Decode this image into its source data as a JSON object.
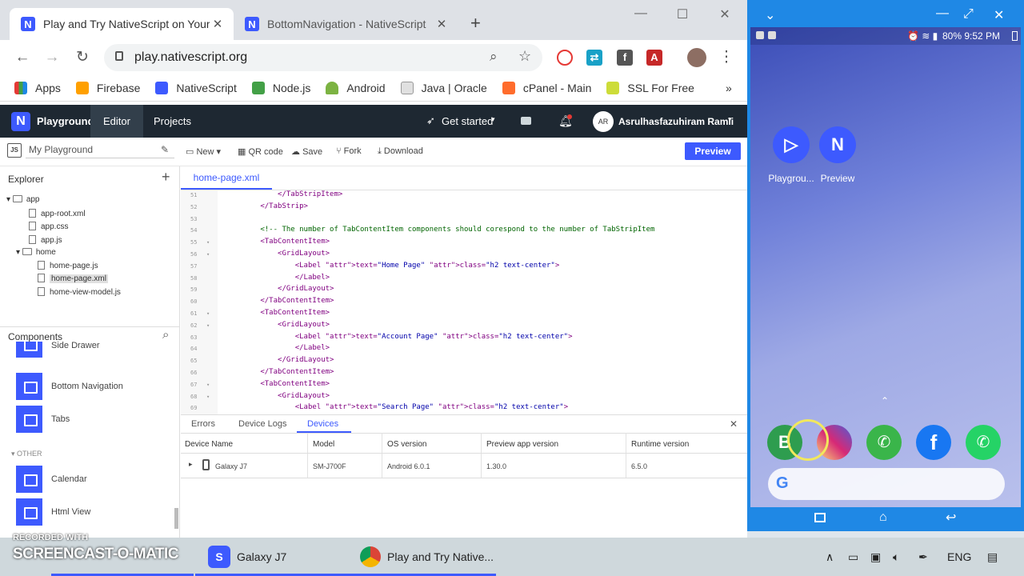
{
  "browser": {
    "tabs": [
      {
        "title": "Play and Try NativeScript on Your",
        "active": true
      },
      {
        "title": "BottomNavigation - NativeScript",
        "active": false
      }
    ],
    "url": "play.nativescript.org",
    "bookmarks": [
      "Apps",
      "Firebase",
      "NativeScript",
      "Node.js",
      "Android",
      "Java | Oracle",
      "cPanel - Main",
      "SSL For Free"
    ],
    "bookmarks_more": "»"
  },
  "app": {
    "brand": "Playground",
    "nav": [
      "Editor",
      "Projects"
    ],
    "get_started": "Get started",
    "user_initials": "AR",
    "user_name": "Asrulhasfazuhiram Ramli",
    "project_name": "My Playground",
    "toolbar": {
      "new": "New",
      "qr": "QR code",
      "save": "Save",
      "fork": "Fork",
      "download": "Download",
      "preview": "Preview"
    },
    "explorer_title": "Explorer",
    "tree": [
      {
        "label": "app",
        "type": "folder"
      },
      {
        "label": "app-root.xml",
        "type": "file"
      },
      {
        "label": "app.css",
        "type": "file"
      },
      {
        "label": "app.js",
        "type": "file"
      },
      {
        "label": "home",
        "type": "folder"
      },
      {
        "label": "home-page.js",
        "type": "file"
      },
      {
        "label": "home-page.xml",
        "type": "file",
        "selected": true
      },
      {
        "label": "home-view-model.js",
        "type": "file"
      }
    ],
    "components_title": "Components",
    "components": [
      "Side Drawer",
      "Bottom Navigation",
      "Tabs"
    ],
    "components_section": "OTHER",
    "components_other": [
      "Calendar",
      "Html View"
    ],
    "editor_tab": "home-page.xml",
    "code": [
      {
        "ln": "51",
        "t": "            </TabStripItem>"
      },
      {
        "ln": "52",
        "t": "        </TabStrip>"
      },
      {
        "ln": "53",
        "t": ""
      },
      {
        "ln": "54",
        "t": "        <!-- The number of TabContentItem components should corespond to the number of TabStripItem"
      },
      {
        "ln": "55",
        "t": "        <TabContentItem>"
      },
      {
        "ln": "56",
        "t": "            <GridLayout>"
      },
      {
        "ln": "57",
        "t": "                <Label text=\"Home Page\" class=\"h2 text-center\">"
      },
      {
        "ln": "58",
        "t": "                </Label>"
      },
      {
        "ln": "59",
        "t": "            </GridLayout>"
      },
      {
        "ln": "60",
        "t": "        </TabContentItem>"
      },
      {
        "ln": "61",
        "t": "        <TabContentItem>"
      },
      {
        "ln": "62",
        "t": "            <GridLayout>"
      },
      {
        "ln": "63",
        "t": "                <Label text=\"Account Page\" class=\"h2 text-center\">"
      },
      {
        "ln": "64",
        "t": "                </Label>"
      },
      {
        "ln": "65",
        "t": "            </GridLayout>"
      },
      {
        "ln": "66",
        "t": "        </TabContentItem>"
      },
      {
        "ln": "67",
        "t": "        <TabContentItem>"
      },
      {
        "ln": "68",
        "t": "            <GridLayout>"
      },
      {
        "ln": "69",
        "t": "                <Label text=\"Search Page\" class=\"h2 text-center\">"
      }
    ],
    "bottom_tabs": [
      "Errors",
      "Device Logs",
      "Devices"
    ],
    "device_headers": [
      "Device Name",
      "Model",
      "OS version",
      "Preview app version",
      "Runtime version"
    ],
    "device_row": [
      "Galaxy J7",
      "SM-J700F",
      "Android 6.0.1",
      "1.30.0",
      "6.5.0"
    ]
  },
  "phone": {
    "status": "80% 9:52 PM",
    "apps": [
      "Playgrou...",
      "Preview"
    ],
    "dock_colors": [
      "#2e9d4f",
      "#c13584",
      "#3ab54a",
      "#1877f2",
      "#25d366"
    ]
  },
  "taskbar": {
    "apps": [
      "Galaxy J7",
      "Play and Try Native..."
    ],
    "lang": "ENG",
    "recorded_with": "RECORDED WITH",
    "screencast": "SCREENCAST-O-MATIC"
  },
  "colors": {
    "accent": "#3d5afe",
    "nav_bg": "#1e2832",
    "phone_bg": "#1f88e5"
  }
}
